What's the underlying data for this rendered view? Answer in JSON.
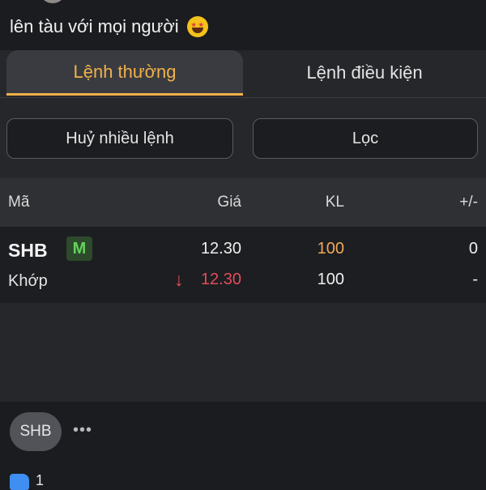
{
  "post": {
    "text": "lên tàu với mọi người",
    "emoji": "star-struck-emoji"
  },
  "tabs": [
    {
      "label": "Lệnh thường"
    },
    {
      "label": "Lệnh điều kiện"
    }
  ],
  "actions": {
    "cancel_label": "Huỷ nhiều lệnh",
    "filter_label": "Lọc"
  },
  "table": {
    "headers": {
      "code": "Mã",
      "price": "Giá",
      "volume": "KL",
      "change": "+/-"
    },
    "rows": [
      {
        "symbol": "SHB",
        "badge": "M",
        "order_price": "12.30",
        "order_volume": "100",
        "change": "0",
        "status": "Khớp",
        "match_arrow": "↓",
        "match_price": "12.30",
        "match_volume": "100",
        "match_change": "-"
      }
    ]
  },
  "tag": "SHB",
  "more": "•••",
  "likes": "1",
  "colors": {
    "accent": "#f0b14a",
    "down": "#e24d5c",
    "badge": "#63d35a",
    "volume": "#f0a95a"
  }
}
